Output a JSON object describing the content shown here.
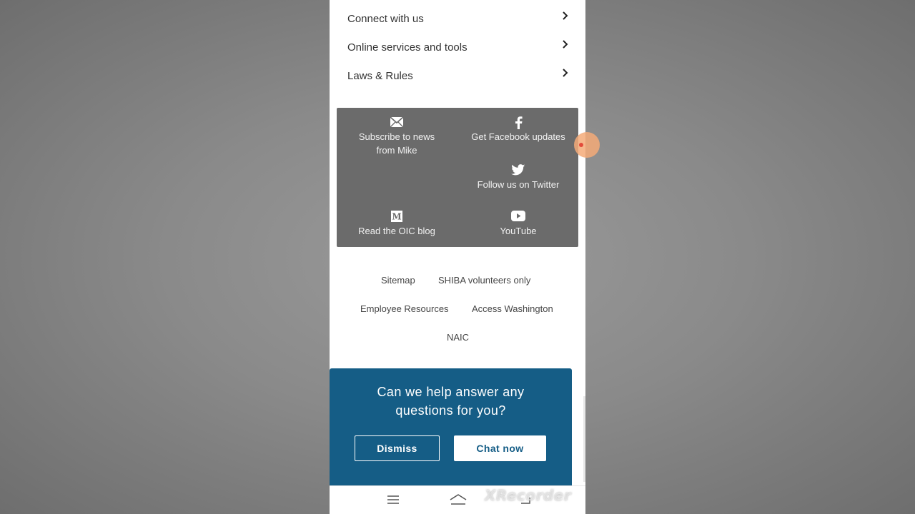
{
  "menu": {
    "items": [
      {
        "label": "Connect with us"
      },
      {
        "label": "Online services and tools"
      },
      {
        "label": "Laws & Rules"
      }
    ]
  },
  "social": {
    "subscribe": {
      "line1": "Subscribe to news",
      "line2": "from Mike",
      "icon": "envelope-icon"
    },
    "facebook": {
      "label": "Get Facebook updates",
      "icon": "facebook-icon"
    },
    "twitter": {
      "label": "Follow us on Twitter",
      "icon": "twitter-icon"
    },
    "blog": {
      "label": "Read the OIC blog",
      "icon": "medium-icon"
    },
    "youtube": {
      "label": "YouTube",
      "icon": "youtube-icon"
    }
  },
  "footer_links": {
    "sitemap": "Sitemap",
    "shiba": "SHIBA volunteers only",
    "employee": "Employee Resources",
    "access": "Access Washington",
    "naic": "NAIC"
  },
  "chat": {
    "question_line1": "Can we help answer any",
    "question_line2": "questions for you?",
    "dismiss_label": "Dismiss",
    "chat_label": "Chat now",
    "background_color": "#155d86"
  },
  "watermark": "XRecorder",
  "colors": {
    "panel_bg": "#6b6b6b",
    "chat_accent": "#155d86"
  }
}
